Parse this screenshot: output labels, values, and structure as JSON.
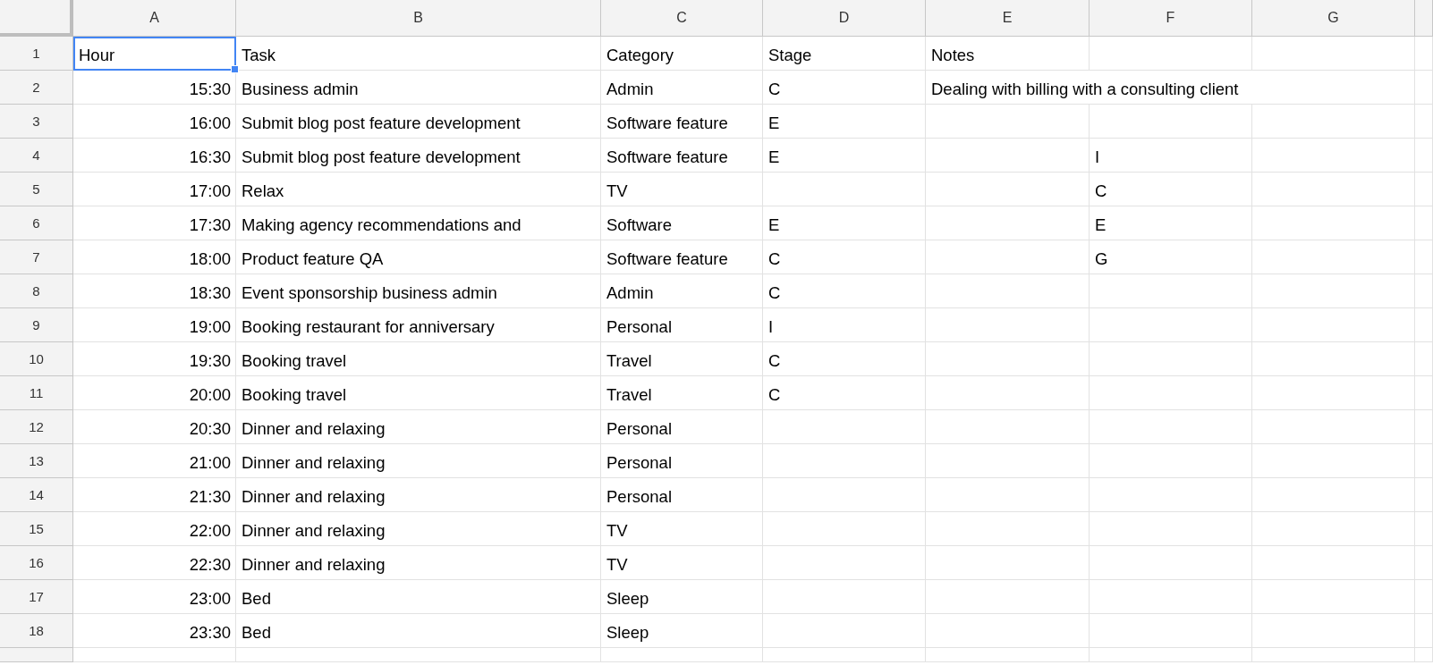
{
  "columns": [
    "A",
    "B",
    "C",
    "D",
    "E",
    "F",
    "G"
  ],
  "rows": [
    {
      "number": "1",
      "selected": true,
      "hour": "Hour",
      "task": "Task",
      "category": "Category",
      "stage": "Stage",
      "notes": "Notes"
    },
    {
      "number": "2",
      "selected": false,
      "hour": "15:30",
      "task": "Business admin",
      "category": "Admin",
      "stage": "C",
      "notes": "Dealing with billing with a consulting client"
    },
    {
      "number": "3",
      "selected": false,
      "hour": "16:00",
      "task": "Submit blog post feature development",
      "category": "Software feature",
      "stage": "E"
    },
    {
      "number": "4",
      "selected": false,
      "hour": "16:30",
      "task": "Submit blog post feature development",
      "category": "Software feature",
      "stage": "E",
      "column_f": "I"
    },
    {
      "number": "5",
      "selected": false,
      "hour": "17:00",
      "task": "Relax",
      "category": "TV",
      "column_f": "C"
    },
    {
      "number": "6",
      "selected": false,
      "hour": "17:30",
      "task": "Making agency recommendations and",
      "category": "Software",
      "stage": "E",
      "column_f": "E"
    },
    {
      "number": "7",
      "selected": false,
      "hour": "18:00",
      "task": "Product feature QA",
      "category": "Software feature",
      "stage": "C",
      "column_f": "G"
    },
    {
      "number": "8",
      "selected": false,
      "hour": "18:30",
      "task": "Event sponsorship business admin",
      "category": "Admin",
      "stage": "C"
    },
    {
      "number": "9",
      "selected": false,
      "hour": "19:00",
      "task": "Booking restaurant for anniversary",
      "category": "Personal",
      "stage": "I"
    },
    {
      "number": "10",
      "selected": false,
      "hour": "19:30",
      "task": "Booking travel",
      "category": "Travel",
      "stage": "C"
    },
    {
      "number": "11",
      "selected": false,
      "hour": "20:00",
      "task": "Booking travel",
      "category": "Travel",
      "stage": "C"
    },
    {
      "number": "12",
      "selected": false,
      "hour": "20:30",
      "task": "Dinner and relaxing",
      "category": "Personal"
    },
    {
      "number": "13",
      "selected": false,
      "hour": "21:00",
      "task": "Dinner and relaxing",
      "category": "Personal"
    },
    {
      "number": "14",
      "selected": false,
      "hour": "21:30",
      "task": "Dinner and relaxing",
      "category": "Personal"
    },
    {
      "number": "15",
      "selected": false,
      "hour": "22:00",
      "task": "Dinner and relaxing",
      "category": "TV"
    },
    {
      "number": "16",
      "selected": false,
      "hour": "22:30",
      "task": "Dinner and relaxing",
      "category": "TV"
    },
    {
      "number": "17",
      "selected": false,
      "hour": "23:00",
      "task": "Bed",
      "category": "Sleep"
    },
    {
      "number": "18",
      "selected": false,
      "hour": "23:30",
      "task": "Bed",
      "category": "Sleep"
    }
  ]
}
